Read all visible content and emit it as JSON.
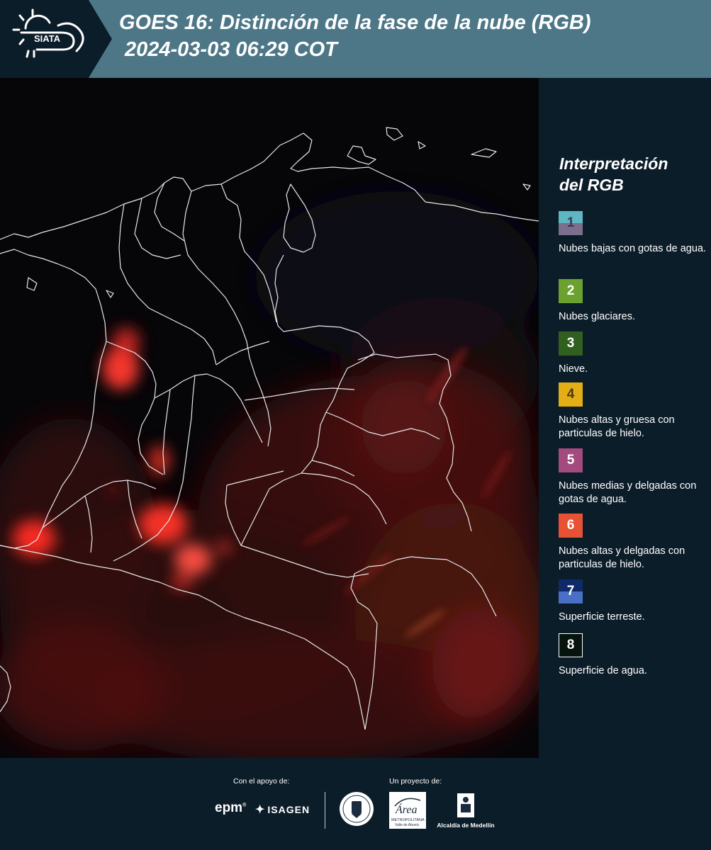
{
  "header": {
    "title_line_1": "GOES 16: Distinción de la fase de la nube (RGB)",
    "title_line_2": "2024-03-03 06:29 COT",
    "logo_text": "SIATA"
  },
  "legend": {
    "title_line_1": "Interpretación",
    "title_line_2": "del RGB",
    "items": [
      {
        "number": "1",
        "label": "Nubes bajas con gotas de agua.",
        "color_top": "#5fb7c4",
        "color_bottom": "#7c6f8e"
      },
      {
        "number": "2",
        "label": "Nubes glaciares.",
        "color": "#6aa12f"
      },
      {
        "number": "3",
        "label": "Nieve.",
        "color": "#305f1f"
      },
      {
        "number": "4",
        "label": "Nubes altas y gruesa con particulas de hielo.",
        "color": "#e3ad16"
      },
      {
        "number": "5",
        "label": "Nubes medias y delgadas con gotas de agua.",
        "color": "#a34b7f"
      },
      {
        "number": "6",
        "label": "Nubes altas y delgadas con particulas de hielo.",
        "color": "#e85234"
      },
      {
        "number": "7",
        "label": "Superficie terreste.",
        "color_top": "#0f2a68",
        "color_bottom": "#4a6fc6"
      },
      {
        "number": "8",
        "label": "Superficie de agua.",
        "color": "#07140e"
      }
    ]
  },
  "footer": {
    "support_caption": "Con el apoyo de:",
    "project_caption": "Un proyecto de:",
    "epm": "epm",
    "isagen": "ISAGEN",
    "area_line_1": "Área",
    "area_line_2": "METROPOLITANA",
    "area_line_3": "Valle de Aburrá",
    "alcaldia": "Alcaldía de Medellín"
  }
}
